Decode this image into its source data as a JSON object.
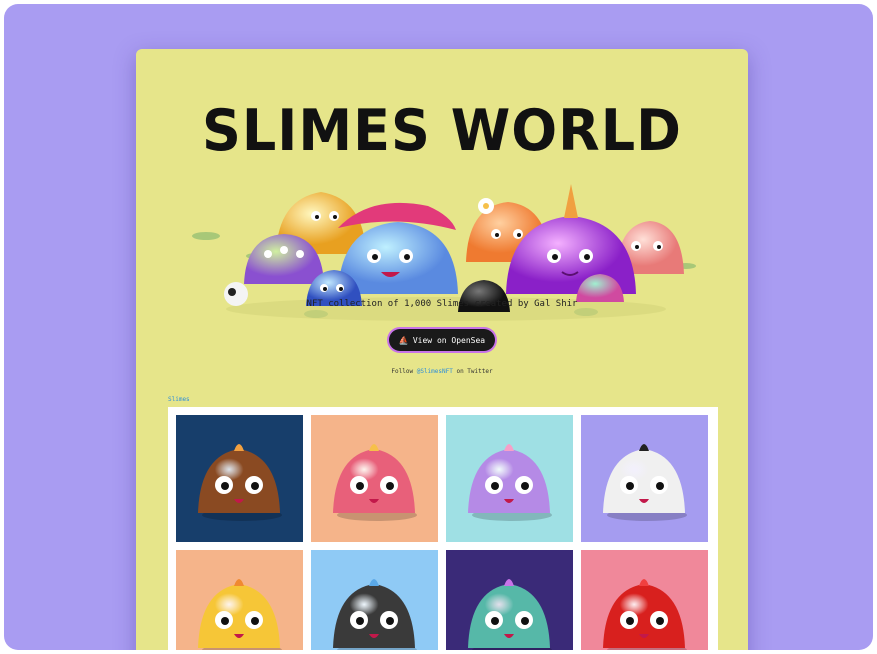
{
  "hero": {
    "title": "SLIMES WORLD",
    "tagline": "NFT collection of 1,000 Slimes created by Gal Shir",
    "cta_label": "View on OpenSea",
    "cta_icon": "ship-icon",
    "follow_prefix": "Follow",
    "follow_handle": "@SlimesNFT",
    "follow_suffix": "on Twitter"
  },
  "gallery": {
    "section_label": "Slimes",
    "tiles": [
      {
        "bg": "#173e6b",
        "slime": "#8a4a22",
        "accent": "#f2a040"
      },
      {
        "bg": "#f5b48a",
        "slime": "#e8607a",
        "accent": "#f6c04a"
      },
      {
        "bg": "#9fe0e4",
        "slime": "#b58ae6",
        "accent": "#f6a0c8"
      },
      {
        "bg": "#a59cf0",
        "slime": "#f0f0f0",
        "accent": "#222222"
      },
      {
        "bg": "#f5b48a",
        "slime": "#f6c637",
        "accent": "#f08a30"
      },
      {
        "bg": "#8fcaf5",
        "slime": "#3a3a3a",
        "accent": "#5aa8e8"
      },
      {
        "bg": "#3a2a78",
        "slime": "#56b8a8",
        "accent": "#c874e8"
      },
      {
        "bg": "#f0889a",
        "slime": "#d8201e",
        "accent": "#f04040"
      }
    ]
  },
  "colors": {
    "frame": "#a99cf2",
    "page": "#e6e58a",
    "button": "#1a1a1a",
    "link": "#2f8fd8"
  }
}
